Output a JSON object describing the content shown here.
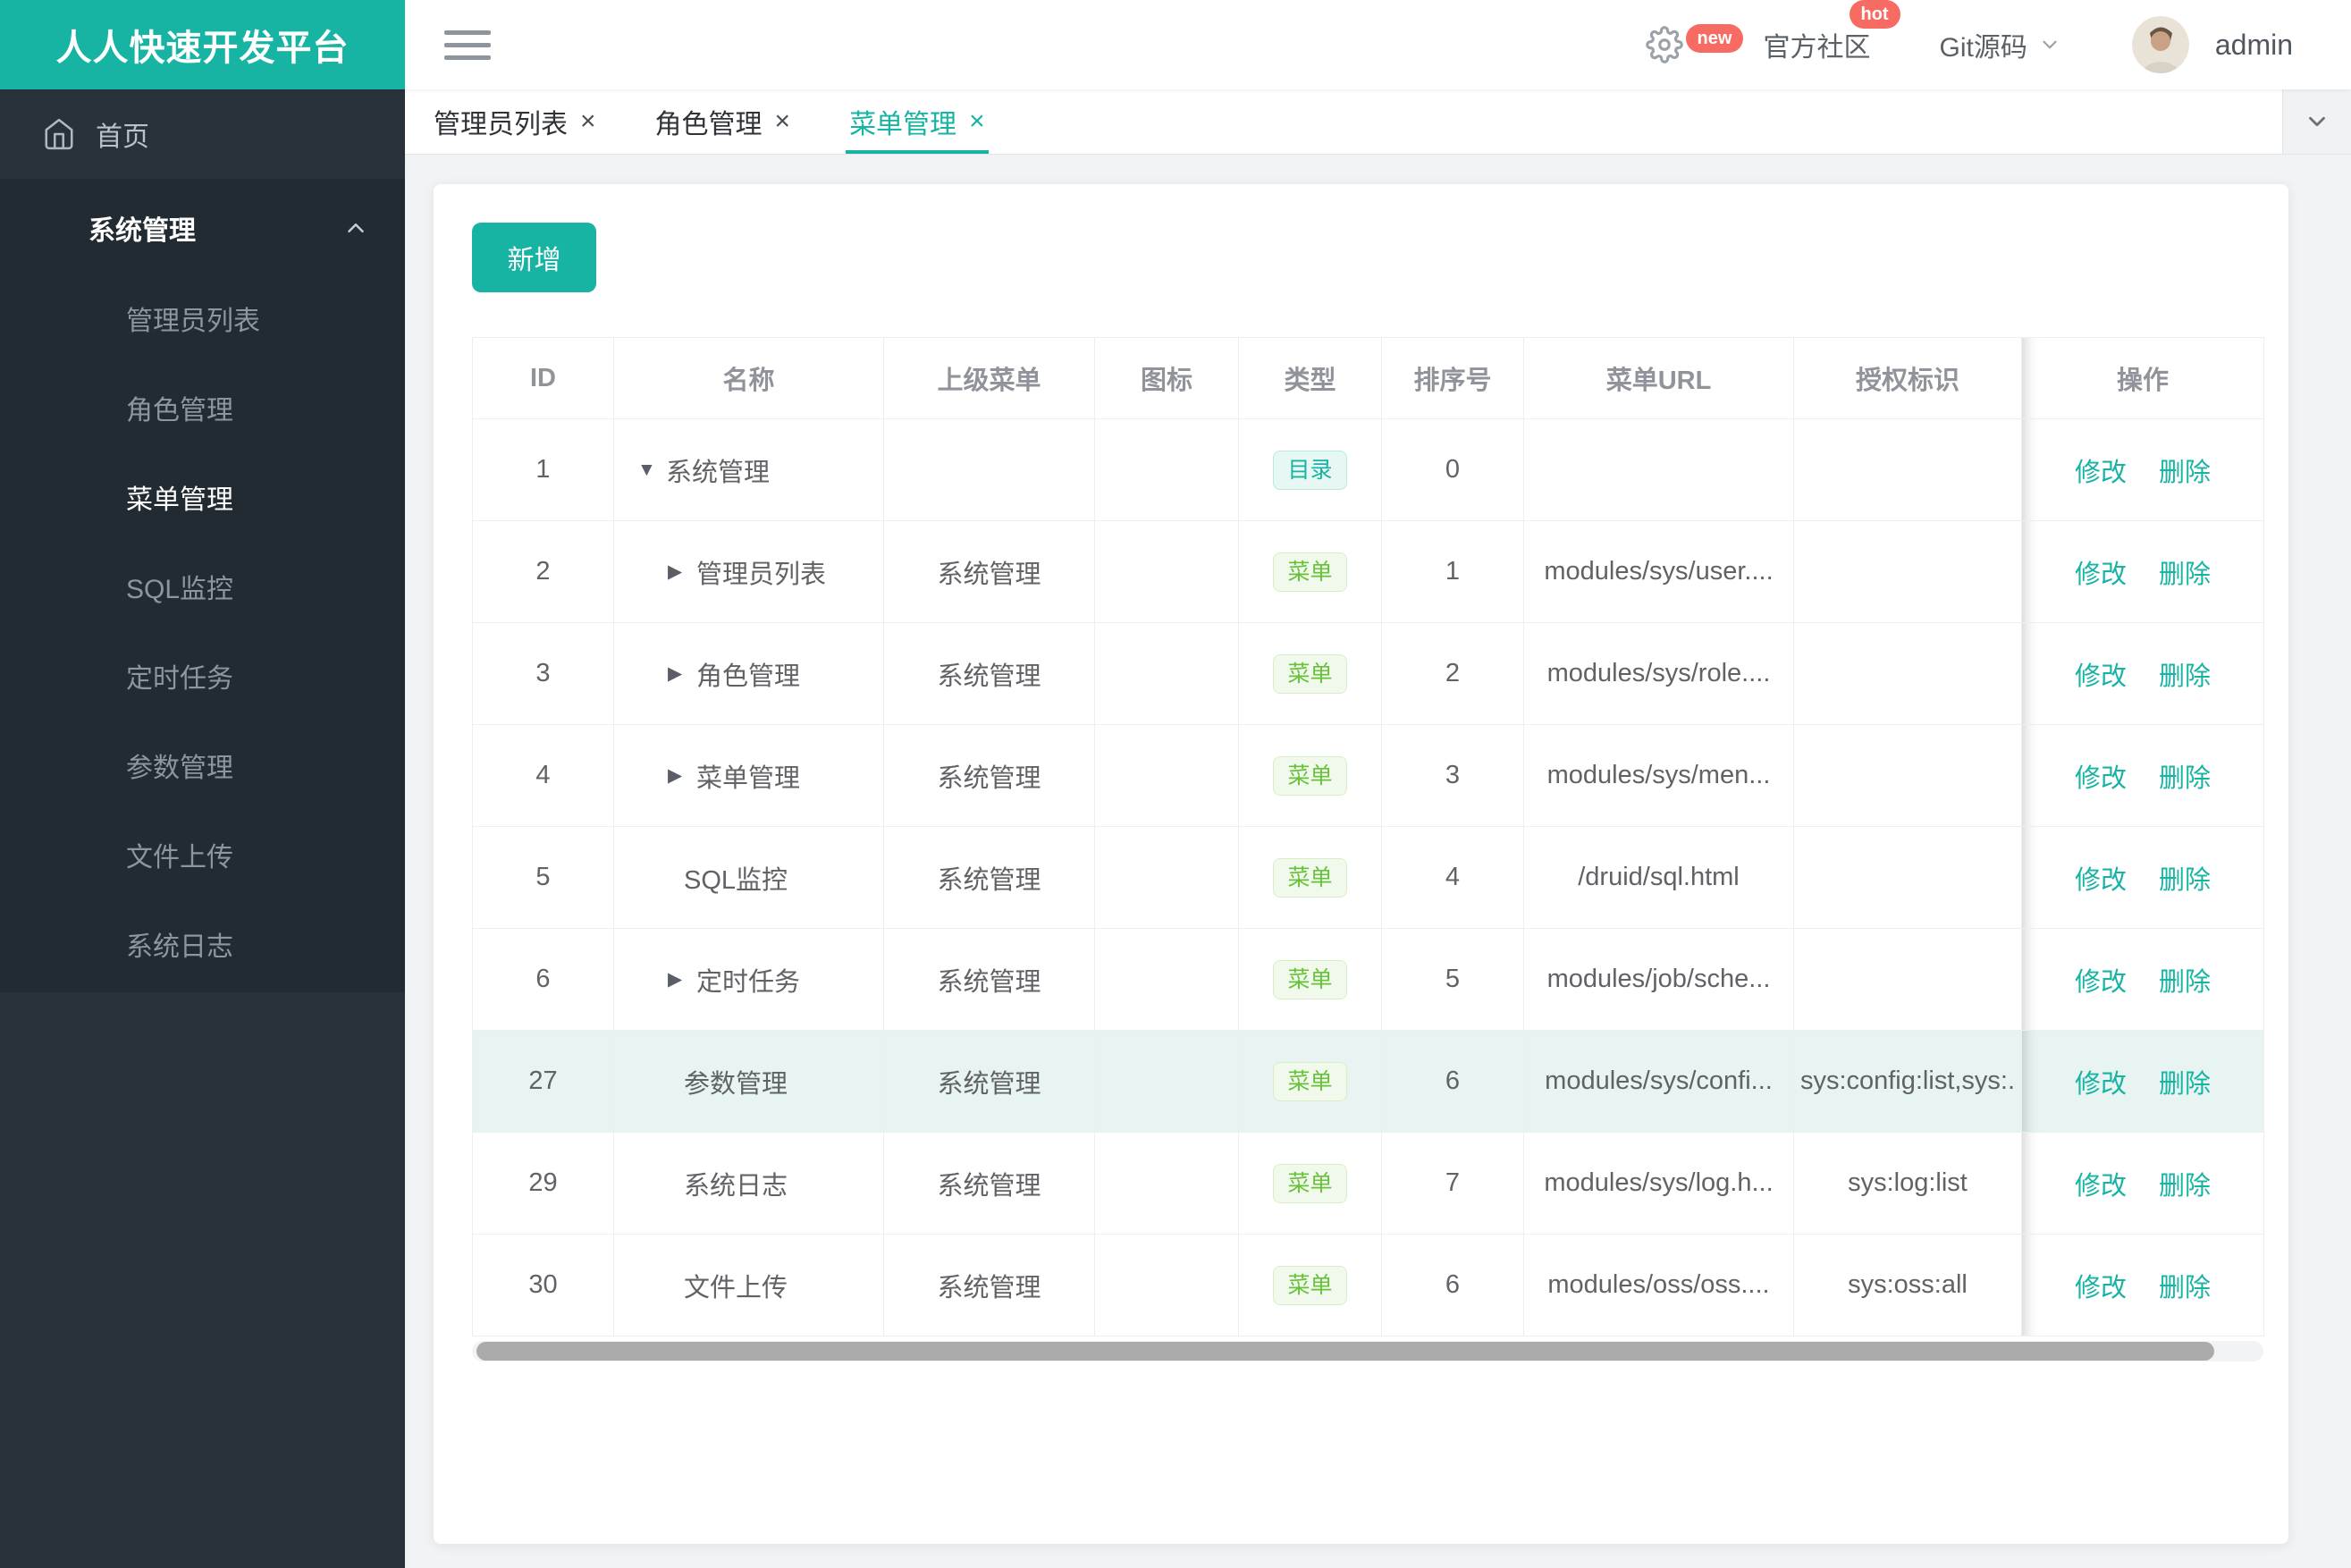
{
  "app": {
    "title": "人人快速开发平台"
  },
  "topbar": {
    "gear_badge": "new",
    "community_label": "官方社区",
    "community_badge": "hot",
    "git_label": "Git源码",
    "username": "admin"
  },
  "sidebar": {
    "home_label": "首页",
    "group_label": "系统管理",
    "items": [
      {
        "label": "管理员列表",
        "active": false
      },
      {
        "label": "角色管理",
        "active": false
      },
      {
        "label": "菜单管理",
        "active": true
      },
      {
        "label": "SQL监控",
        "active": false
      },
      {
        "label": "定时任务",
        "active": false
      },
      {
        "label": "参数管理",
        "active": false
      },
      {
        "label": "文件上传",
        "active": false
      },
      {
        "label": "系统日志",
        "active": false
      }
    ]
  },
  "tabs": [
    {
      "label": "管理员列表",
      "active": false
    },
    {
      "label": "角色管理",
      "active": false
    },
    {
      "label": "菜单管理",
      "active": true
    }
  ],
  "icons": {
    "close_glyph": "×",
    "tri_down": "▼",
    "tri_right": "▶"
  },
  "toolbar": {
    "add_label": "新增"
  },
  "table": {
    "columns": [
      "ID",
      "名称",
      "上级菜单",
      "图标",
      "类型",
      "排序号",
      "菜单URL",
      "授权标识",
      "操作"
    ],
    "type_badges": {
      "dir": "目录",
      "menu": "菜单"
    },
    "actions": {
      "edit": "修改",
      "delete": "删除"
    },
    "rows": [
      {
        "id": "1",
        "name": "系统管理",
        "arrow": "down",
        "level": 0,
        "parent": "",
        "type": "dir",
        "order": "0",
        "url": "",
        "perm": "",
        "highlight": false
      },
      {
        "id": "2",
        "name": "管理员列表",
        "arrow": "right",
        "level": 1,
        "parent": "系统管理",
        "type": "menu",
        "order": "1",
        "url": "modules/sys/user....",
        "perm": "",
        "highlight": false
      },
      {
        "id": "3",
        "name": "角色管理",
        "arrow": "right",
        "level": 1,
        "parent": "系统管理",
        "type": "menu",
        "order": "2",
        "url": "modules/sys/role....",
        "perm": "",
        "highlight": false
      },
      {
        "id": "4",
        "name": "菜单管理",
        "arrow": "right",
        "level": 1,
        "parent": "系统管理",
        "type": "menu",
        "order": "3",
        "url": "modules/sys/men...",
        "perm": "",
        "highlight": false
      },
      {
        "id": "5",
        "name": "SQL监控",
        "arrow": null,
        "level": 1,
        "parent": "系统管理",
        "type": "menu",
        "order": "4",
        "url": "/druid/sql.html",
        "perm": "",
        "highlight": false
      },
      {
        "id": "6",
        "name": "定时任务",
        "arrow": "right",
        "level": 1,
        "parent": "系统管理",
        "type": "menu",
        "order": "5",
        "url": "modules/job/sche...",
        "perm": "",
        "highlight": false
      },
      {
        "id": "27",
        "name": "参数管理",
        "arrow": null,
        "level": 1,
        "parent": "系统管理",
        "type": "menu",
        "order": "6",
        "url": "modules/sys/confi...",
        "perm": "sys:config:list,sys:.",
        "highlight": true
      },
      {
        "id": "29",
        "name": "系统日志",
        "arrow": null,
        "level": 1,
        "parent": "系统管理",
        "type": "menu",
        "order": "7",
        "url": "modules/sys/log.h...",
        "perm": "sys:log:list",
        "highlight": false
      },
      {
        "id": "30",
        "name": "文件上传",
        "arrow": null,
        "level": 1,
        "parent": "系统管理",
        "type": "menu",
        "order": "6",
        "url": "modules/oss/oss....",
        "perm": "sys:oss:all",
        "highlight": false
      }
    ]
  },
  "colors": {
    "accent": "#17B3A3",
    "success": "#67C23A",
    "badge_red": "#F86B62",
    "sidebar_bg": "#29323A",
    "sidebar_panel_bg": "#222B31",
    "highlight_row": "#E7F4F1",
    "table_border": "#EBEEF5"
  }
}
